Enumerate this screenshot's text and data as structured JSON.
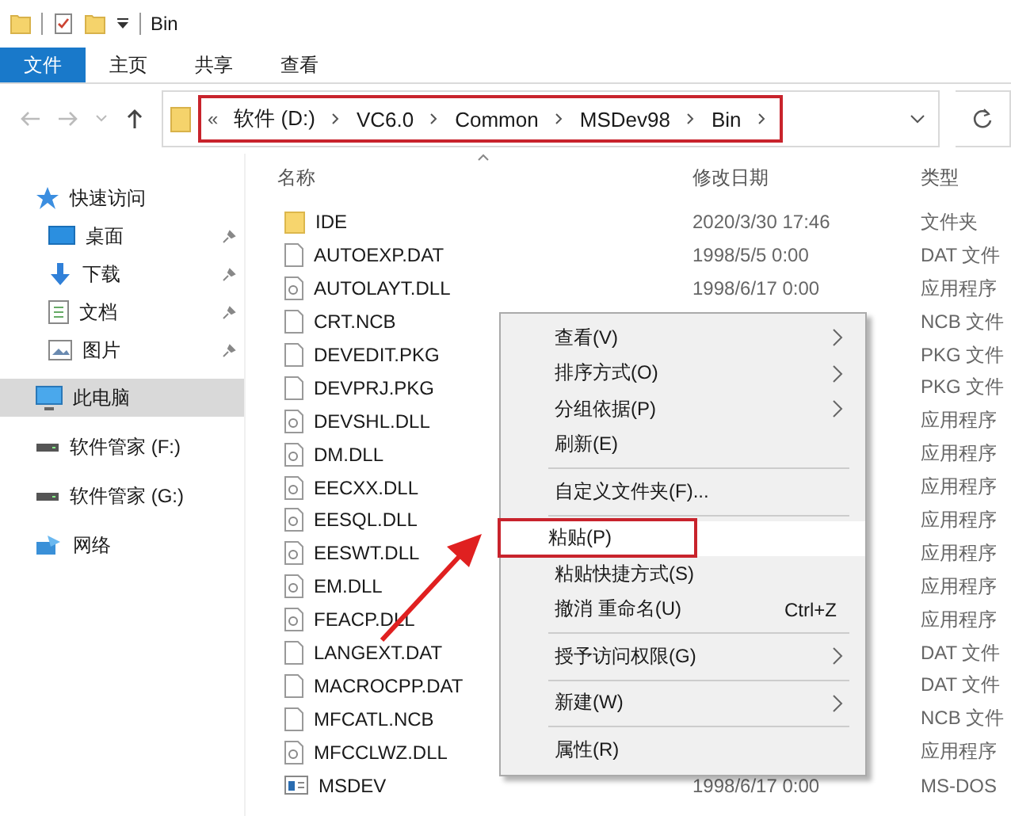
{
  "window": {
    "title": "Bin"
  },
  "ribbon_tabs": [
    {
      "label": "文件",
      "selected": true
    },
    {
      "label": "主页",
      "selected": false
    },
    {
      "label": "共享",
      "selected": false
    },
    {
      "label": "查看",
      "selected": false
    }
  ],
  "address_bar": {
    "overflow": "«",
    "segments": [
      "软件 (D:)",
      "VC6.0",
      "Common",
      "MSDev98",
      "Bin"
    ],
    "annotated": true
  },
  "sidebar": {
    "items": [
      {
        "label": "快速访问",
        "kind": "star",
        "pinned": false,
        "selected": false,
        "indent": false
      },
      {
        "label": "桌面",
        "kind": "desktop",
        "pinned": true,
        "selected": false,
        "indent": true
      },
      {
        "label": "下载",
        "kind": "download",
        "pinned": true,
        "selected": false,
        "indent": true
      },
      {
        "label": "文档",
        "kind": "document",
        "pinned": true,
        "selected": false,
        "indent": true
      },
      {
        "label": "图片",
        "kind": "pictures",
        "pinned": true,
        "selected": false,
        "indent": true
      },
      {
        "label": "此电脑",
        "kind": "pc",
        "pinned": false,
        "selected": true,
        "indent": false
      },
      {
        "label": "软件管家 (F:)",
        "kind": "drive",
        "pinned": false,
        "selected": false,
        "indent": false
      },
      {
        "label": "软件管家 (G:)",
        "kind": "drive",
        "pinned": false,
        "selected": false,
        "indent": false
      },
      {
        "label": "网络",
        "kind": "network",
        "pinned": false,
        "selected": false,
        "indent": false
      }
    ]
  },
  "table": {
    "columns": [
      "名称",
      "修改日期",
      "类型"
    ],
    "rows": [
      {
        "name": "IDE",
        "kind": "folder",
        "date": "2020/3/30 17:46",
        "type": "文件夹"
      },
      {
        "name": "AUTOEXP.DAT",
        "kind": "file",
        "date": "1998/5/5 0:00",
        "type": "DAT 文件"
      },
      {
        "name": "AUTOLAYT.DLL",
        "kind": "dll",
        "date": "1998/6/17 0:00",
        "type": "应用程序"
      },
      {
        "name": "CRT.NCB",
        "kind": "file",
        "type": "NCB 文件"
      },
      {
        "name": "DEVEDIT.PKG",
        "kind": "file",
        "type": "PKG 文件"
      },
      {
        "name": "DEVPRJ.PKG",
        "kind": "file",
        "type": "PKG 文件"
      },
      {
        "name": "DEVSHL.DLL",
        "kind": "dll",
        "type": "应用程序"
      },
      {
        "name": "DM.DLL",
        "kind": "dll",
        "type": "应用程序"
      },
      {
        "name": "EECXX.DLL",
        "kind": "dll",
        "type": "应用程序"
      },
      {
        "name": "EESQL.DLL",
        "kind": "dll",
        "type": "应用程序"
      },
      {
        "name": "EESWT.DLL",
        "kind": "dll",
        "type": "应用程序"
      },
      {
        "name": "EM.DLL",
        "kind": "dll",
        "type": "应用程序"
      },
      {
        "name": "FEACP.DLL",
        "kind": "dll",
        "type": "应用程序"
      },
      {
        "name": "LANGEXT.DAT",
        "kind": "file",
        "type": "DAT 文件"
      },
      {
        "name": "MACROCPP.DAT",
        "kind": "file",
        "type": "DAT 文件"
      },
      {
        "name": "MFCATL.NCB",
        "kind": "file",
        "type": "NCB 文件"
      },
      {
        "name": "MFCCLWZ.DLL",
        "kind": "dll",
        "type": "应用程序"
      },
      {
        "name": "MSDEV",
        "kind": "app",
        "date": "1998/6/17 0:00",
        "type": "MS-DOS"
      }
    ]
  },
  "context_menu": {
    "items": [
      {
        "kind": "item",
        "label": "查看(V)",
        "submenu": true,
        "selected": false,
        "annotated": false
      },
      {
        "kind": "item",
        "label": "排序方式(O)",
        "submenu": true,
        "selected": false,
        "annotated": false
      },
      {
        "kind": "item",
        "label": "分组依据(P)",
        "submenu": true,
        "selected": false,
        "annotated": false
      },
      {
        "kind": "item",
        "label": "刷新(E)",
        "submenu": false,
        "selected": false,
        "annotated": false
      },
      {
        "kind": "separator"
      },
      {
        "kind": "item",
        "label": "自定义文件夹(F)...",
        "submenu": false,
        "selected": false,
        "annotated": false
      },
      {
        "kind": "separator"
      },
      {
        "kind": "item",
        "label": "粘贴(P)",
        "submenu": false,
        "selected": true,
        "annotated": true
      },
      {
        "kind": "item",
        "label": "粘贴快捷方式(S)",
        "submenu": false,
        "selected": false,
        "annotated": false
      },
      {
        "kind": "item",
        "label": "撤消 重命名(U)",
        "shortcut": "Ctrl+Z",
        "submenu": false,
        "selected": false,
        "annotated": false
      },
      {
        "kind": "separator"
      },
      {
        "kind": "item",
        "label": "授予访问权限(G)",
        "submenu": true,
        "selected": false,
        "annotated": false
      },
      {
        "kind": "separator"
      },
      {
        "kind": "item",
        "label": "新建(W)",
        "submenu": true,
        "selected": false,
        "annotated": false
      },
      {
        "kind": "separator"
      },
      {
        "kind": "item",
        "label": "属性(R)",
        "submenu": false,
        "selected": false,
        "annotated": false
      }
    ]
  }
}
